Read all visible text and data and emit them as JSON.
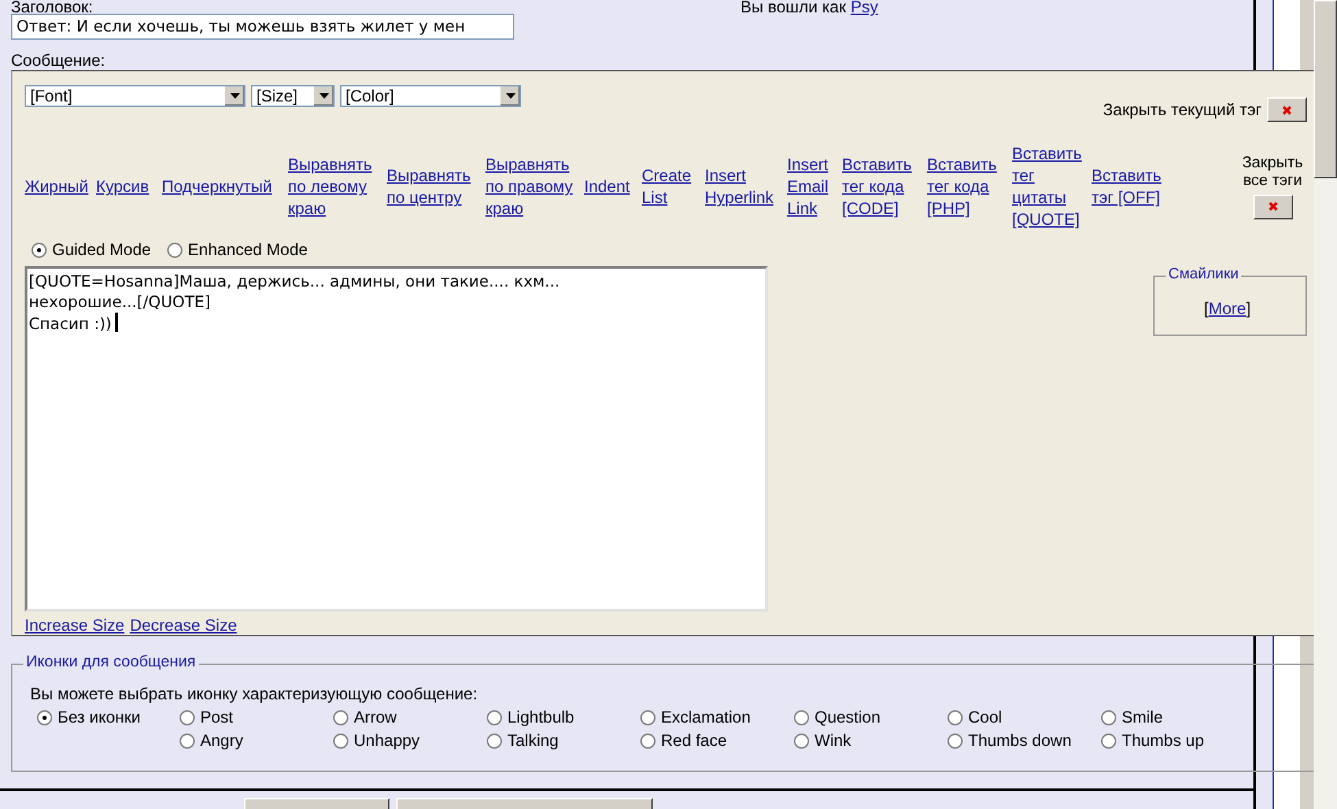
{
  "subject": {
    "label": "Заголовок:",
    "value": "Ответ: И если хочешь, ты можешь взять жилет у мен"
  },
  "login": {
    "text": "Вы вошли как",
    "user": "Psy"
  },
  "message_label": "Сообщение:",
  "selects": [
    {
      "value": "[Font]"
    },
    {
      "value": "[Size]"
    },
    {
      "value": "[Color]"
    }
  ],
  "close_current": "Закрыть текущий тэг",
  "toolbar": [
    "Жирный",
    "Курсив",
    "Подчеркнутый",
    "Выравнять по левому краю",
    "Выравнять по центру",
    "Выравнять по правому краю",
    "Indent",
    "Create List",
    "Insert Hyperlink",
    "Insert Email Link",
    "Вставить тег кода [CODE]",
    "Вставить тег кода [PHP]",
    "Вставить тег цитаты [QUOTE]",
    "Вставить тэг [OFF]"
  ],
  "close_all": "Закрыть все тэги",
  "modes": [
    {
      "label": "Guided Mode",
      "selected": true
    },
    {
      "label": "Enhanced Mode",
      "selected": false
    }
  ],
  "body_text": "[QUOTE=Hosanna]Маша, держись... админы, они такие.... кхм... нехорошие...[/QUOTE]\nСпасип :))",
  "smilies": {
    "legend": "Смайлики",
    "before": "[",
    "link": "More",
    "after": "]"
  },
  "resize_links": [
    "Increase Size",
    "Decrease Size"
  ],
  "icons": {
    "legend": "Иконки для сообщения",
    "prompt": "Вы можете выбрать иконку характеризующую сообщение:",
    "options": [
      {
        "label": "Без иконки",
        "selected": true
      },
      {
        "label": "Post",
        "selected": false
      },
      {
        "label": "Arrow",
        "selected": false
      },
      {
        "label": "Lightbulb",
        "selected": false
      },
      {
        "label": "Exclamation",
        "selected": false
      },
      {
        "label": "Question",
        "selected": false
      },
      {
        "label": "Cool",
        "selected": false
      },
      {
        "label": "Smile",
        "selected": false
      },
      {
        "label": "Angry",
        "selected": false
      },
      {
        "label": "Unhappy",
        "selected": false
      },
      {
        "label": "Talking",
        "selected": false
      },
      {
        "label": "Red face",
        "selected": false
      },
      {
        "label": "Wink",
        "selected": false
      },
      {
        "label": "Thumbs down",
        "selected": false
      },
      {
        "label": "Thumbs up",
        "selected": false
      }
    ]
  }
}
